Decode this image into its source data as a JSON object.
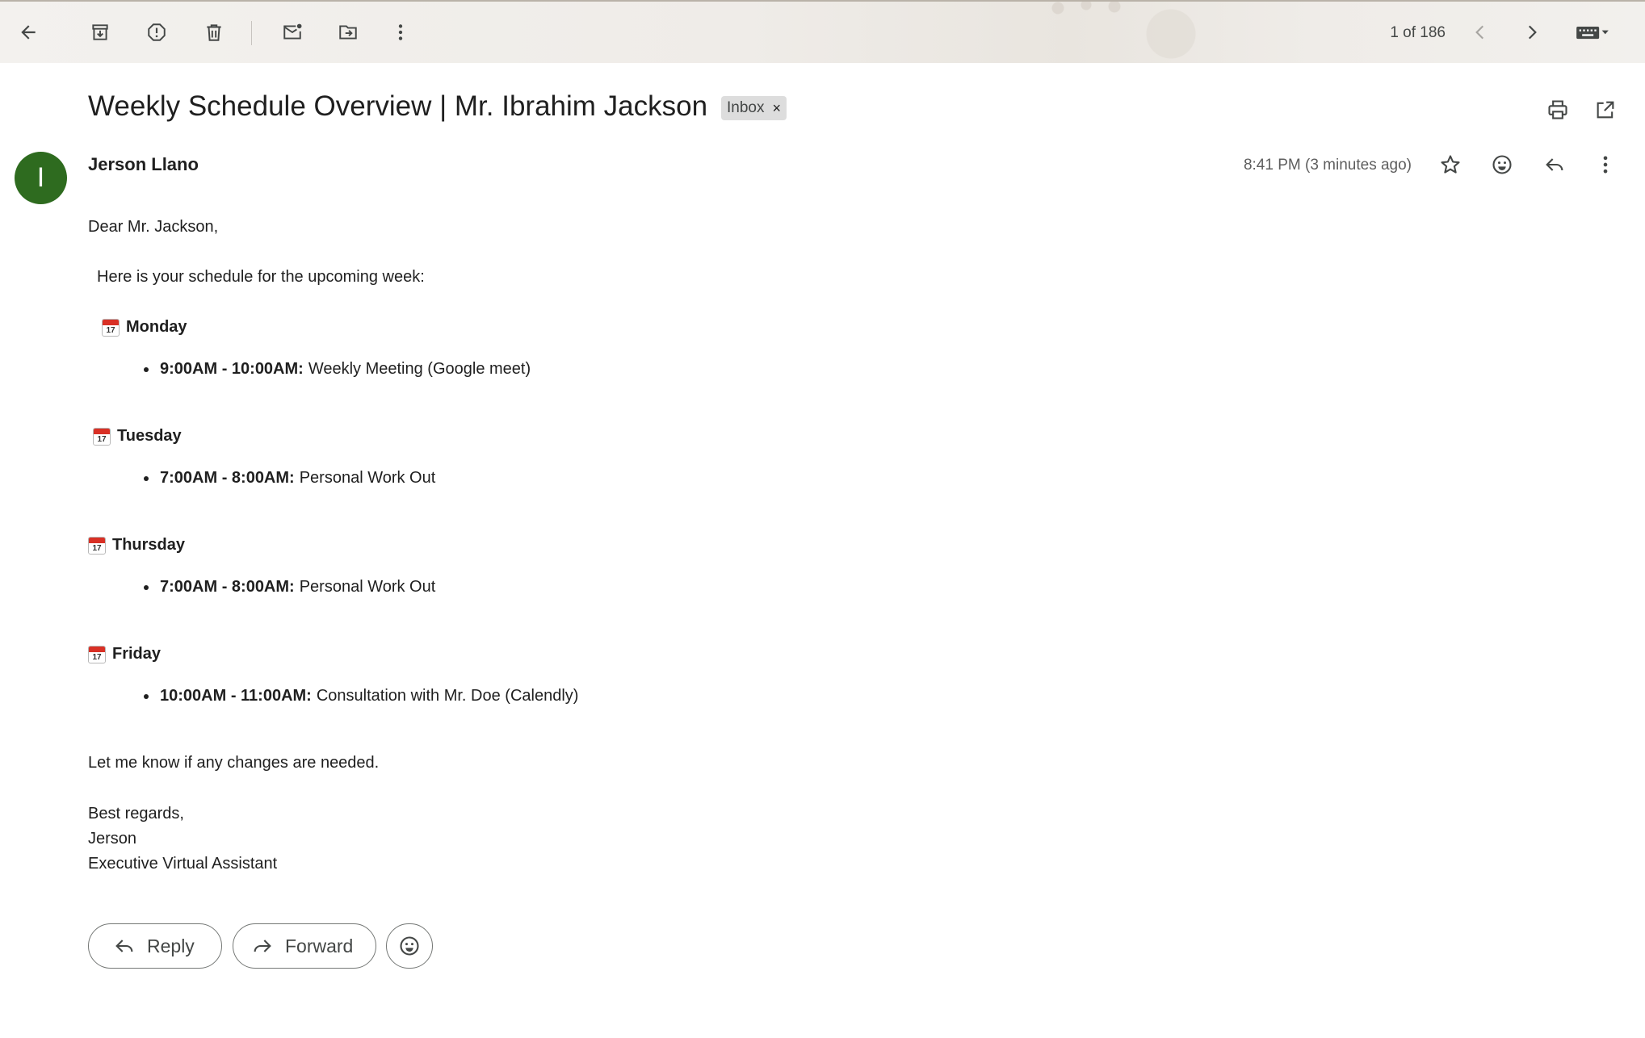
{
  "toolbar": {
    "icons": [
      "back-arrow-icon",
      "archive-icon",
      "report-spam-icon",
      "delete-icon",
      "mark-unread-icon",
      "move-to-icon",
      "more-vert-icon"
    ],
    "pager": "1 of 186"
  },
  "email": {
    "subject": "Weekly Schedule Overview | Mr. Ibrahim Jackson",
    "label": "Inbox",
    "label_remove": "×",
    "sender_initial": "I",
    "sender_name": "Jerson Llano",
    "timestamp": "8:41 PM (3 minutes ago)",
    "avatar_color": "#2e6b1f"
  },
  "body": {
    "greeting": "Dear Mr. Jackson,",
    "intro": "Here is your schedule for the upcoming week:",
    "calendar_icon_number": "17",
    "days": [
      {
        "day": "Monday",
        "items": [
          {
            "time": "9:00AM - 10:00AM:",
            "desc": "Weekly Meeting (Google meet)"
          }
        ]
      },
      {
        "day": "Tuesday",
        "items": [
          {
            "time": "7:00AM - 8:00AM:",
            "desc": "Personal Work Out"
          }
        ]
      },
      {
        "day": "Thursday",
        "items": [
          {
            "time": "7:00AM - 8:00AM:",
            "desc": "Personal Work Out"
          }
        ]
      },
      {
        "day": "Friday",
        "items": [
          {
            "time": "10:00AM - 11:00AM:",
            "desc": "Consultation with Mr. Doe (Calendly)"
          }
        ]
      }
    ],
    "closing": "Let me know if any changes are needed.",
    "signoff": "Best regards,",
    "sig_name": "Jerson",
    "sig_title": "Executive Virtual Assistant"
  },
  "actions": {
    "reply_label": "Reply",
    "forward_label": "Forward"
  }
}
